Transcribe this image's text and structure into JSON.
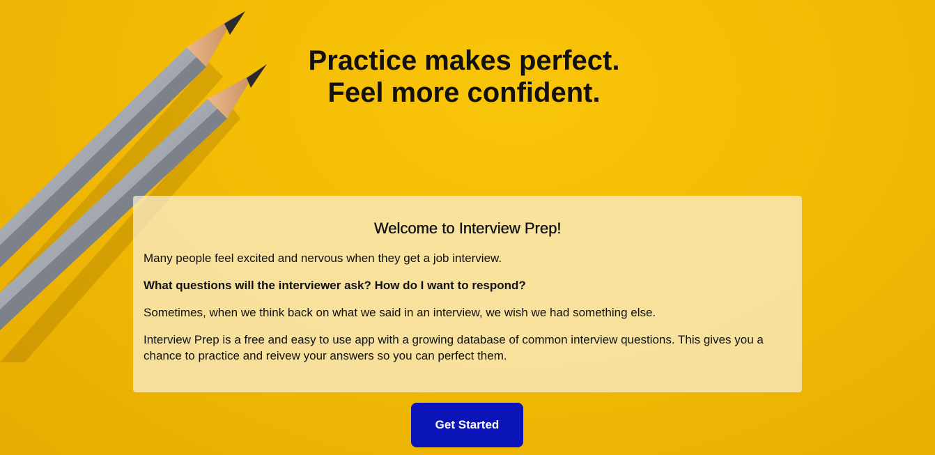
{
  "hero": {
    "headline_line1": "Practice makes perfect.",
    "headline_line2": "Feel more confident.",
    "background_color": "#f3bb05"
  },
  "welcome": {
    "title": "Welcome to Interview Prep!",
    "paragraphs": [
      "Many people feel excited and nervous when they get a job interview.",
      "What questions will the interviewer ask? How do I want to respond?",
      "Sometimes, when we think back on what we said in an interview, we wish we had something else.",
      "Interview Prep is a free and easy to use app with a growing database of common interview questions. This gives you a chance to practice and reivew your answers so you can perfect them."
    ]
  },
  "cta": {
    "label": "Get Started",
    "color": "#0b14b8"
  }
}
